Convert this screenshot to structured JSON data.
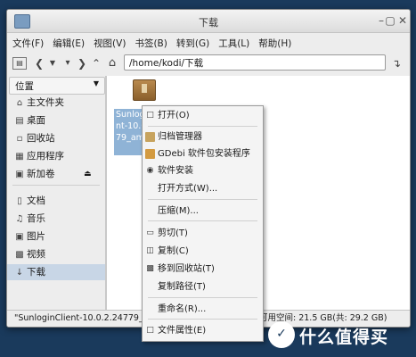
{
  "window": {
    "title": "下载",
    "controls": [
      "minimize",
      "maximize",
      "close"
    ]
  },
  "menubar": [
    "文件(F)",
    "编辑(E)",
    "视图(V)",
    "书签(B)",
    "转到(G)",
    "工具(L)",
    "帮助(H)"
  ],
  "toolbar": {
    "path": "/home/kodi/下载"
  },
  "sidebar": {
    "header": "位置",
    "items": [
      {
        "label": "主文件夹",
        "icon": "home-icon"
      },
      {
        "label": "桌面",
        "icon": "desktop-icon"
      },
      {
        "label": "回收站",
        "icon": "trash-icon"
      },
      {
        "label": "应用程序",
        "icon": "apps-icon"
      },
      {
        "label": "新加卷",
        "icon": "drive-icon"
      },
      {
        "label": "文档",
        "icon": "documents-icon"
      },
      {
        "label": "音乐",
        "icon": "music-icon"
      },
      {
        "label": "图片",
        "icon": "pictures-icon"
      },
      {
        "label": "视频",
        "icon": "videos-icon"
      },
      {
        "label": "下载",
        "icon": "download-icon"
      }
    ]
  },
  "file": {
    "name_lines": [
      "Sunlogi",
      "nt-10.0",
      "79_am",
      "e"
    ]
  },
  "context_menu": [
    {
      "label": "打开(O)",
      "icon": "open-icon"
    },
    {
      "label": "归档管理器",
      "icon": "archive-icon"
    },
    {
      "label": "GDebi 软件包安装程序",
      "icon": "gdebi-icon"
    },
    {
      "label": "软件安装",
      "icon": "software-install-icon"
    },
    {
      "label": "打开方式(W)...",
      "icon": ""
    },
    {
      "label": "压缩(M)...",
      "icon": ""
    },
    {
      "label": "剪切(T)",
      "icon": "cut-icon"
    },
    {
      "label": "复制(C)",
      "icon": "copy-icon"
    },
    {
      "label": "移到回收站(T)",
      "icon": "trash-icon"
    },
    {
      "label": "复制路径(T)",
      "icon": ""
    },
    {
      "label": "重命名(R)...",
      "icon": ""
    },
    {
      "label": "文件属性(E)",
      "icon": "properties-icon"
    }
  ],
  "statusbar": {
    "left": "\"SunloginClient-10.0.2.24779_ar",
    "right": "可用空间: 21.5 GB(共: 29.2 GB)"
  },
  "watermark": {
    "text": "什么值得买"
  }
}
